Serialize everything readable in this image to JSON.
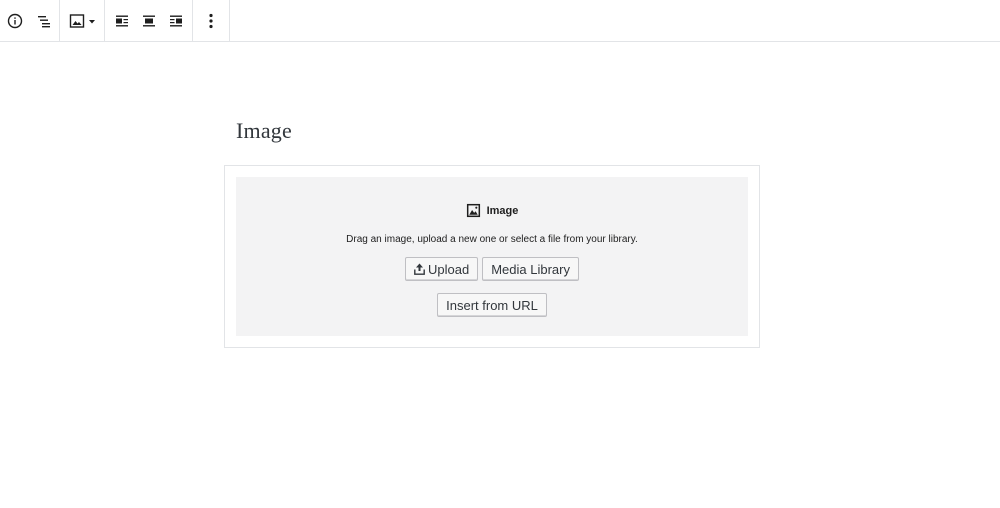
{
  "toolbar": {
    "groups": [
      {
        "items": [
          "info-icon",
          "list-view-icon"
        ]
      },
      {
        "items": [
          "image-icon",
          "dropdown-arrow-icon"
        ]
      },
      {
        "items": [
          "align-left-icon",
          "align-center-icon",
          "align-right-icon"
        ]
      },
      {
        "items": [
          "more-options-icon"
        ]
      }
    ]
  },
  "block": {
    "title": "Image",
    "placeholder": {
      "label": "Image",
      "instructions": "Drag an image, upload a new one or select a file from your library.",
      "upload_label": "Upload",
      "media_library_label": "Media Library",
      "insert_url_label": "Insert from URL"
    }
  },
  "colors": {
    "placeholder_bg": "#f3f3f4",
    "border": "#e2e4e7",
    "button_bg": "#f7f7f7",
    "text": "#32373c"
  }
}
